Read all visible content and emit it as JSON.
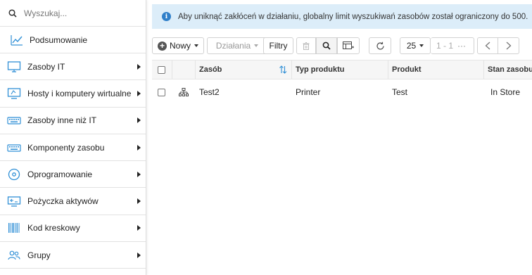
{
  "sidebar": {
    "search_placeholder": "Wyszukaj...",
    "summary_label": "Podsumowanie",
    "items": [
      {
        "label": "Zasoby IT",
        "icon": "monitor-icon"
      },
      {
        "label": "Hosty i komputery wirtualne",
        "icon": "virtual-host-icon"
      },
      {
        "label": "Zasoby inne niż IT",
        "icon": "keyboard-icon"
      },
      {
        "label": "Komponenty zasobu",
        "icon": "component-keyboard-icon"
      },
      {
        "label": "Oprogramowanie",
        "icon": "disc-icon"
      },
      {
        "label": "Pożyczka aktywów",
        "icon": "loan-icon"
      },
      {
        "label": "Kod kreskowy",
        "icon": "barcode-icon"
      },
      {
        "label": "Grupy",
        "icon": "users-icon"
      }
    ]
  },
  "notice": {
    "text": "Aby uniknąć zakłóceń w działaniu, globalny limit wyszukiwań zasobów został ograniczony do 500."
  },
  "toolbar": {
    "new_label": "Nowy",
    "actions_label": "Działania",
    "filters_label": "Filtry",
    "page_size": "25",
    "page_range": "1 - 1",
    "more": "···"
  },
  "table": {
    "columns": [
      "Zasób",
      "Typ produktu",
      "Produkt",
      "Stan zasobu"
    ],
    "rows": [
      {
        "asset": "Test2",
        "product_type": "Printer",
        "product": "Test",
        "state": "In Store"
      }
    ]
  },
  "colors": {
    "accent": "#2f8fd6",
    "notice_bg": "#dcedf9",
    "header_bg": "#f6f6f6"
  }
}
